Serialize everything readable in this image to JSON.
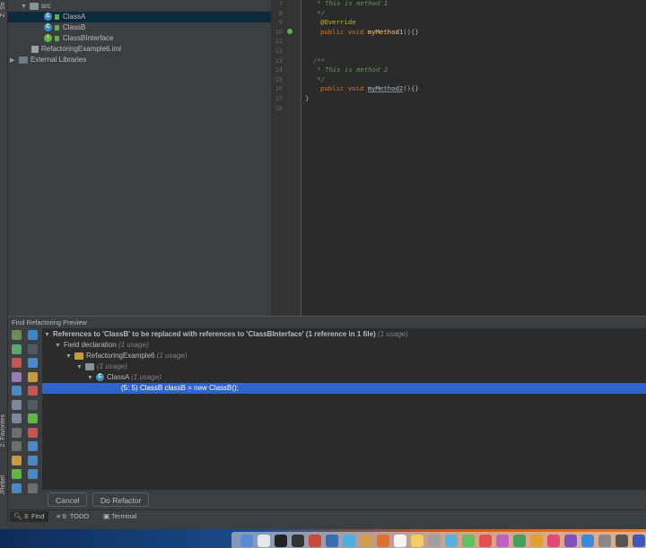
{
  "left_tabs": {
    "structure": "Z: Str",
    "favorites": "2: Favorites",
    "jrebel": "JRebel"
  },
  "project_tree": {
    "items": [
      {
        "label": "src",
        "type": "folder"
      },
      {
        "label": "ClassA",
        "type": "class"
      },
      {
        "label": "ClassB",
        "type": "class"
      },
      {
        "label": "ClassBInterface",
        "type": "interface"
      },
      {
        "label": "RefactoringExample6.iml",
        "type": "file"
      },
      {
        "label": "External Libraries",
        "type": "library"
      }
    ]
  },
  "editor": {
    "line_numbers": [
      "7",
      "8",
      "9",
      "10",
      "11",
      "12",
      "13",
      "14",
      "15",
      "16",
      "17",
      "18"
    ],
    "lines": {
      "l7": "   * This is method 1",
      "l8": "   */",
      "l9_ann": "@Override",
      "l10_kw": "public void ",
      "l10_fn": "myMethod1",
      "l10_rest": "(){}",
      "l13": "  /**",
      "l14": "   * This is method 2",
      "l15": "   */",
      "l16_kw": "public void ",
      "l16_fn": "myMethod2",
      "l16_rest": "(){}",
      "l17": "}"
    }
  },
  "find_panel": {
    "title": "Find Refactoring Preview",
    "header_text": "References to 'ClassB' to be replaced with references to 'ClassBInterface'  (1 reference in 1 file)",
    "header_count": "(1 usage)",
    "field_declaration": "Field declaration",
    "field_declaration_count": "(1 usage)",
    "project": "RefactoringExample6",
    "project_count": "(1 usage)",
    "package_count": "(1 usage)",
    "class_name": "ClassA",
    "class_count": "(1 usage)",
    "usage_line": "(5: 5) ClassB classB = new ClassB();",
    "cancel_label": "Cancel",
    "do_refactor_label": "Do Refactor"
  },
  "bottom_tabs": {
    "find": "3: Find",
    "todo": "6: TODO",
    "terminal": "Terminal"
  },
  "colors": {
    "background": "#2b2b2b",
    "panel": "#3c3f41",
    "selection": "#2f65ca",
    "keyword": "#cc7832",
    "comment": "#629755",
    "annotation": "#bbb529",
    "method": "#ffc66d"
  }
}
